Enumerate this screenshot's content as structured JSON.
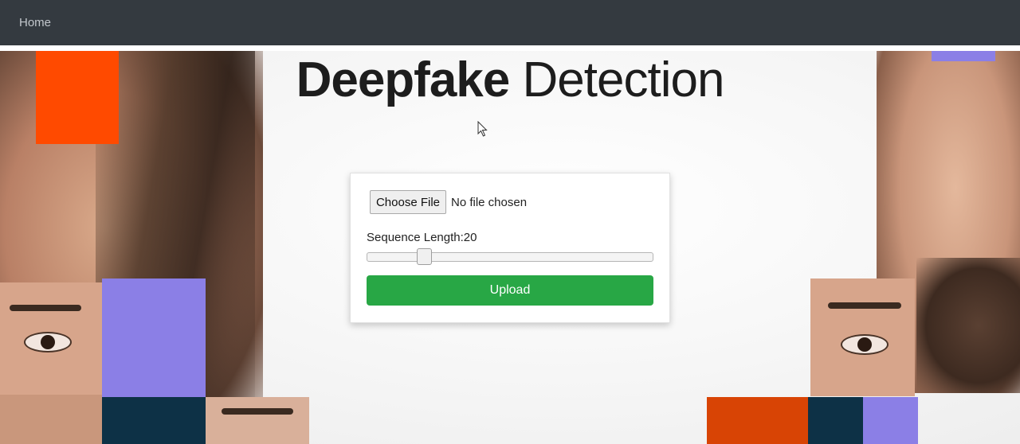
{
  "navbar": {
    "home_label": "Home"
  },
  "title": {
    "bold": "Deepfake",
    "light": "Detection"
  },
  "form": {
    "choose_file_label": "Choose File",
    "file_status": "No file chosen",
    "sequence_label": "Sequence Length:",
    "sequence_value": "20",
    "slider_fraction": 0.2,
    "upload_label": "Upload"
  },
  "colors": {
    "navbar": "#343a40",
    "upload_button": "#28a745",
    "accent_orange": "#ff4a00",
    "accent_purple": "#8b7fe6",
    "accent_navy": "#0d3146"
  },
  "icons": {
    "cursor": "mouse-pointer-icon"
  }
}
